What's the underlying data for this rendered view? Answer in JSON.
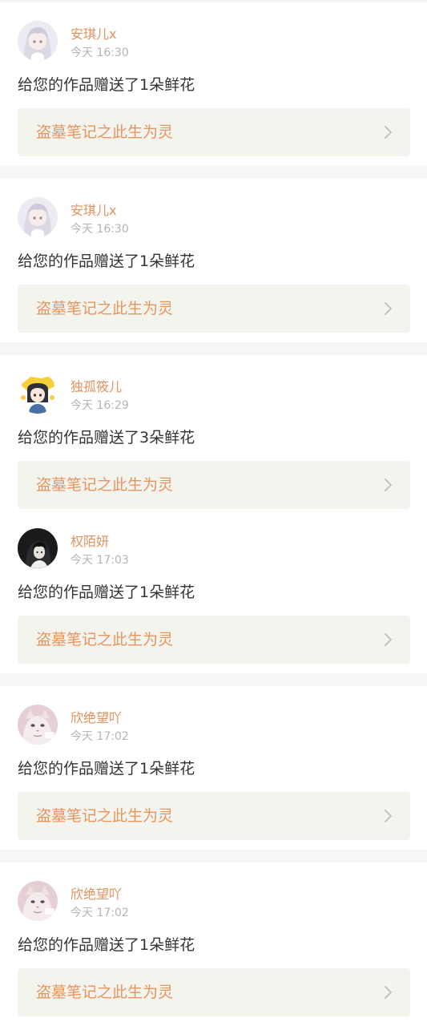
{
  "notifications": [
    {
      "avatar_icon": "anime-girl-white-hair-avatar-icon",
      "username": "安琪儿x",
      "time": "今天 16:30",
      "message": "给您的作品赠送了1朵鲜花",
      "work_title": "盗墓笔记之此生为灵"
    },
    {
      "avatar_icon": "anime-girl-white-hair-avatar-icon",
      "username": "安琪儿x",
      "time": "今天 16:30",
      "message": "给您的作品赠送了1朵鲜花",
      "work_title": "盗墓笔记之此生为灵"
    },
    {
      "avatar_icon": "anime-girl-yellow-hat-avatar-icon",
      "username": "独孤筱儿",
      "time": "今天 16:29",
      "message": "给您的作品赠送了3朵鲜花",
      "work_title": "盗墓笔记之此生为灵"
    },
    {
      "avatar_icon": "dark-portrait-avatar-icon",
      "username": "权陌妍",
      "time": "今天 17:03",
      "message": "给您的作品赠送了1朵鲜花",
      "work_title": "盗墓笔记之此生为灵"
    },
    {
      "avatar_icon": "cat-face-avatar-icon",
      "username": "欣绝望吖",
      "time": "今天 17:02",
      "message": "给您的作品赠送了1朵鲜花",
      "work_title": "盗墓笔记之此生为灵"
    },
    {
      "avatar_icon": "cat-face-avatar-icon",
      "username": "欣绝望吖",
      "time": "今天 17:02",
      "message": "给您的作品赠送了1朵鲜花",
      "work_title": "盗墓笔记之此生为灵"
    }
  ],
  "colors": {
    "username": "#e0925e",
    "work_title": "#e6955e",
    "time": "#b4b4b4",
    "message": "#333333",
    "link_background": "#f4f4ef",
    "separator": "#f6f6f6"
  }
}
